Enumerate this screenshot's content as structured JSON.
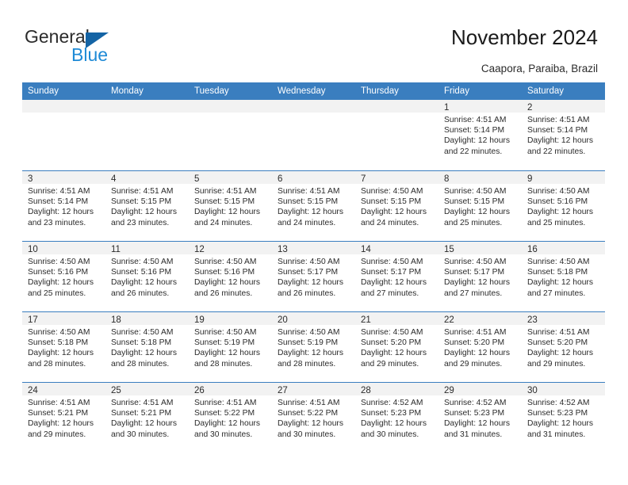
{
  "brand": {
    "name_part1": "General",
    "name_part2": "Blue",
    "triangle_color": "#1464a5",
    "blue_color": "#1e8ad6"
  },
  "header": {
    "title": "November 2024",
    "subtitle": "Caapora, Paraiba, Brazil"
  },
  "theme": {
    "header_row_bg": "#3a7ebf",
    "row_divider": "#3a7ebf",
    "day_number_band_bg": "#f2f2f2",
    "text": "#2b2b2b"
  },
  "weekdays": [
    "Sunday",
    "Monday",
    "Tuesday",
    "Wednesday",
    "Thursday",
    "Friday",
    "Saturday"
  ],
  "weeks": [
    [
      {
        "empty": true
      },
      {
        "empty": true
      },
      {
        "empty": true
      },
      {
        "empty": true
      },
      {
        "empty": true
      },
      {
        "day": "1",
        "sunrise": "Sunrise: 4:51 AM",
        "sunset": "Sunset: 5:14 PM",
        "daylight1": "Daylight: 12 hours",
        "daylight2": "and 22 minutes."
      },
      {
        "day": "2",
        "sunrise": "Sunrise: 4:51 AM",
        "sunset": "Sunset: 5:14 PM",
        "daylight1": "Daylight: 12 hours",
        "daylight2": "and 22 minutes."
      }
    ],
    [
      {
        "day": "3",
        "sunrise": "Sunrise: 4:51 AM",
        "sunset": "Sunset: 5:14 PM",
        "daylight1": "Daylight: 12 hours",
        "daylight2": "and 23 minutes."
      },
      {
        "day": "4",
        "sunrise": "Sunrise: 4:51 AM",
        "sunset": "Sunset: 5:15 PM",
        "daylight1": "Daylight: 12 hours",
        "daylight2": "and 23 minutes."
      },
      {
        "day": "5",
        "sunrise": "Sunrise: 4:51 AM",
        "sunset": "Sunset: 5:15 PM",
        "daylight1": "Daylight: 12 hours",
        "daylight2": "and 24 minutes."
      },
      {
        "day": "6",
        "sunrise": "Sunrise: 4:51 AM",
        "sunset": "Sunset: 5:15 PM",
        "daylight1": "Daylight: 12 hours",
        "daylight2": "and 24 minutes."
      },
      {
        "day": "7",
        "sunrise": "Sunrise: 4:50 AM",
        "sunset": "Sunset: 5:15 PM",
        "daylight1": "Daylight: 12 hours",
        "daylight2": "and 24 minutes."
      },
      {
        "day": "8",
        "sunrise": "Sunrise: 4:50 AM",
        "sunset": "Sunset: 5:15 PM",
        "daylight1": "Daylight: 12 hours",
        "daylight2": "and 25 minutes."
      },
      {
        "day": "9",
        "sunrise": "Sunrise: 4:50 AM",
        "sunset": "Sunset: 5:16 PM",
        "daylight1": "Daylight: 12 hours",
        "daylight2": "and 25 minutes."
      }
    ],
    [
      {
        "day": "10",
        "sunrise": "Sunrise: 4:50 AM",
        "sunset": "Sunset: 5:16 PM",
        "daylight1": "Daylight: 12 hours",
        "daylight2": "and 25 minutes."
      },
      {
        "day": "11",
        "sunrise": "Sunrise: 4:50 AM",
        "sunset": "Sunset: 5:16 PM",
        "daylight1": "Daylight: 12 hours",
        "daylight2": "and 26 minutes."
      },
      {
        "day": "12",
        "sunrise": "Sunrise: 4:50 AM",
        "sunset": "Sunset: 5:16 PM",
        "daylight1": "Daylight: 12 hours",
        "daylight2": "and 26 minutes."
      },
      {
        "day": "13",
        "sunrise": "Sunrise: 4:50 AM",
        "sunset": "Sunset: 5:17 PM",
        "daylight1": "Daylight: 12 hours",
        "daylight2": "and 26 minutes."
      },
      {
        "day": "14",
        "sunrise": "Sunrise: 4:50 AM",
        "sunset": "Sunset: 5:17 PM",
        "daylight1": "Daylight: 12 hours",
        "daylight2": "and 27 minutes."
      },
      {
        "day": "15",
        "sunrise": "Sunrise: 4:50 AM",
        "sunset": "Sunset: 5:17 PM",
        "daylight1": "Daylight: 12 hours",
        "daylight2": "and 27 minutes."
      },
      {
        "day": "16",
        "sunrise": "Sunrise: 4:50 AM",
        "sunset": "Sunset: 5:18 PM",
        "daylight1": "Daylight: 12 hours",
        "daylight2": "and 27 minutes."
      }
    ],
    [
      {
        "day": "17",
        "sunrise": "Sunrise: 4:50 AM",
        "sunset": "Sunset: 5:18 PM",
        "daylight1": "Daylight: 12 hours",
        "daylight2": "and 28 minutes."
      },
      {
        "day": "18",
        "sunrise": "Sunrise: 4:50 AM",
        "sunset": "Sunset: 5:18 PM",
        "daylight1": "Daylight: 12 hours",
        "daylight2": "and 28 minutes."
      },
      {
        "day": "19",
        "sunrise": "Sunrise: 4:50 AM",
        "sunset": "Sunset: 5:19 PM",
        "daylight1": "Daylight: 12 hours",
        "daylight2": "and 28 minutes."
      },
      {
        "day": "20",
        "sunrise": "Sunrise: 4:50 AM",
        "sunset": "Sunset: 5:19 PM",
        "daylight1": "Daylight: 12 hours",
        "daylight2": "and 28 minutes."
      },
      {
        "day": "21",
        "sunrise": "Sunrise: 4:50 AM",
        "sunset": "Sunset: 5:20 PM",
        "daylight1": "Daylight: 12 hours",
        "daylight2": "and 29 minutes."
      },
      {
        "day": "22",
        "sunrise": "Sunrise: 4:51 AM",
        "sunset": "Sunset: 5:20 PM",
        "daylight1": "Daylight: 12 hours",
        "daylight2": "and 29 minutes."
      },
      {
        "day": "23",
        "sunrise": "Sunrise: 4:51 AM",
        "sunset": "Sunset: 5:20 PM",
        "daylight1": "Daylight: 12 hours",
        "daylight2": "and 29 minutes."
      }
    ],
    [
      {
        "day": "24",
        "sunrise": "Sunrise: 4:51 AM",
        "sunset": "Sunset: 5:21 PM",
        "daylight1": "Daylight: 12 hours",
        "daylight2": "and 29 minutes."
      },
      {
        "day": "25",
        "sunrise": "Sunrise: 4:51 AM",
        "sunset": "Sunset: 5:21 PM",
        "daylight1": "Daylight: 12 hours",
        "daylight2": "and 30 minutes."
      },
      {
        "day": "26",
        "sunrise": "Sunrise: 4:51 AM",
        "sunset": "Sunset: 5:22 PM",
        "daylight1": "Daylight: 12 hours",
        "daylight2": "and 30 minutes."
      },
      {
        "day": "27",
        "sunrise": "Sunrise: 4:51 AM",
        "sunset": "Sunset: 5:22 PM",
        "daylight1": "Daylight: 12 hours",
        "daylight2": "and 30 minutes."
      },
      {
        "day": "28",
        "sunrise": "Sunrise: 4:52 AM",
        "sunset": "Sunset: 5:23 PM",
        "daylight1": "Daylight: 12 hours",
        "daylight2": "and 30 minutes."
      },
      {
        "day": "29",
        "sunrise": "Sunrise: 4:52 AM",
        "sunset": "Sunset: 5:23 PM",
        "daylight1": "Daylight: 12 hours",
        "daylight2": "and 31 minutes."
      },
      {
        "day": "30",
        "sunrise": "Sunrise: 4:52 AM",
        "sunset": "Sunset: 5:23 PM",
        "daylight1": "Daylight: 12 hours",
        "daylight2": "and 31 minutes."
      }
    ]
  ]
}
